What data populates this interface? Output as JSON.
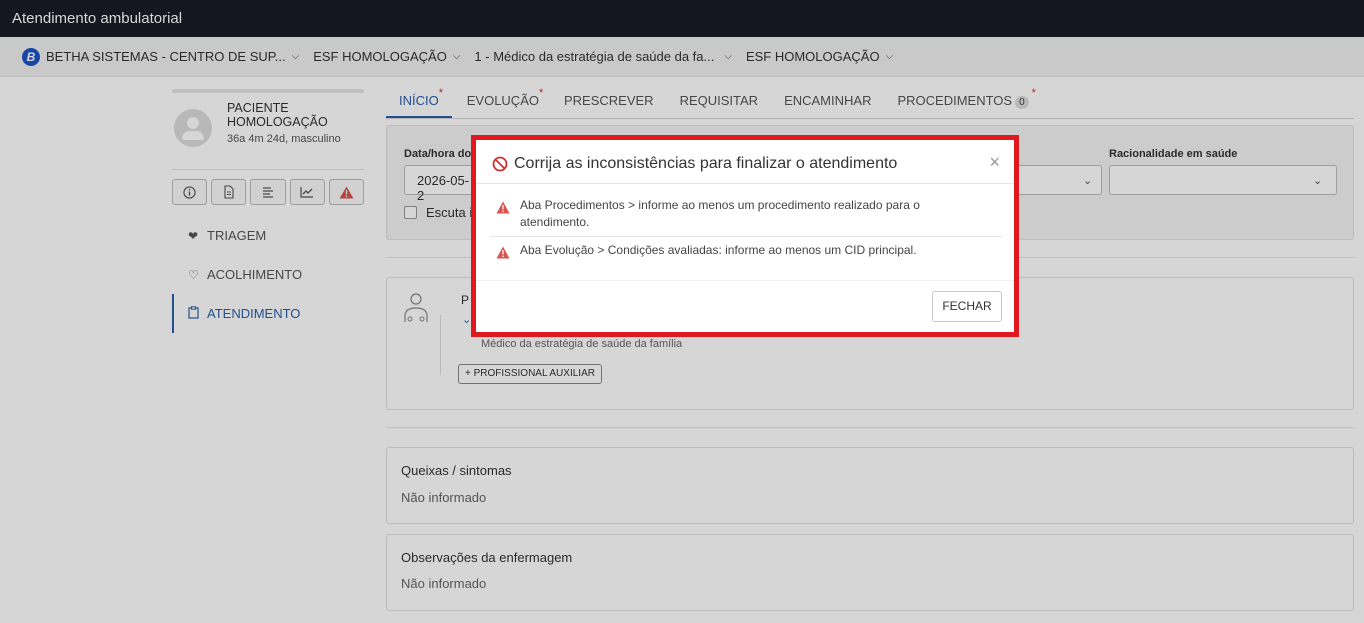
{
  "window": {
    "title": "Atendimento ambulatorial"
  },
  "context_bar": {
    "logo_letter": "B",
    "items": [
      {
        "label": "BETHA SISTEMAS - CENTRO DE SUP..."
      },
      {
        "label": "ESF HOMOLOGAÇÃO"
      },
      {
        "label": "1 - Médico da estratégia de saúde da fa..."
      },
      {
        "label": "ESF HOMOLOGAÇÃO"
      }
    ]
  },
  "patient": {
    "name": "PACIENTE HOMOLOGAÇÃO",
    "meta": "36a 4m 24d, masculino"
  },
  "sidebar": {
    "action_icons": [
      "info-icon",
      "document-icon",
      "list-icon",
      "chart-icon",
      "warning-icon"
    ],
    "items": [
      {
        "label": "TRIAGEM",
        "icon": "heartbeat-icon"
      },
      {
        "label": "ACOLHIMENTO",
        "icon": "heart-icon"
      },
      {
        "label": "ATENDIMENTO",
        "icon": "clipboard-icon",
        "active": true
      }
    ]
  },
  "tabs": [
    {
      "label": "INÍCIO",
      "required": "*",
      "active": true
    },
    {
      "label": "EVOLUÇÃO",
      "required": "*"
    },
    {
      "label": "PRESCREVER"
    },
    {
      "label": "REQUISITAR"
    },
    {
      "label": "ENCAMINHAR"
    },
    {
      "label": "PROCEDIMENTOS",
      "badge": "0",
      "required": "*"
    }
  ],
  "form": {
    "date_label": "Data/hora do",
    "date_value": "2026-05-2",
    "rationality_label": "Racionalidade em saúde",
    "rationality_value": "",
    "escuta_label": "Escuta i"
  },
  "professional": {
    "label_fragment": "P",
    "role": "Médico da estratégia de saúde da família",
    "add_aux_button": "PROFISSIONAL AUXILIAR",
    "add_symbol": "+"
  },
  "cards": [
    {
      "title": "Queixas / sintomas",
      "value": "Não informado"
    },
    {
      "title": "Observações da enfermagem",
      "value": "Não informado"
    }
  ],
  "modal": {
    "title": "Corrija as inconsistências para finalizar o atendimento",
    "close_symbol": "×",
    "messages": [
      {
        "text": "Aba Procedimentos > informe ao menos um procedimento realizado para o atendimento."
      },
      {
        "text": "Aba Evolução > Condições avaliadas: informe ao menos um CID principal."
      }
    ],
    "close_button": "FECHAR"
  },
  "colors": {
    "accent": "#2b5fa8",
    "error_frame": "#e0191f",
    "required": "#d32f2f",
    "titlebar": "#1b1b28"
  }
}
